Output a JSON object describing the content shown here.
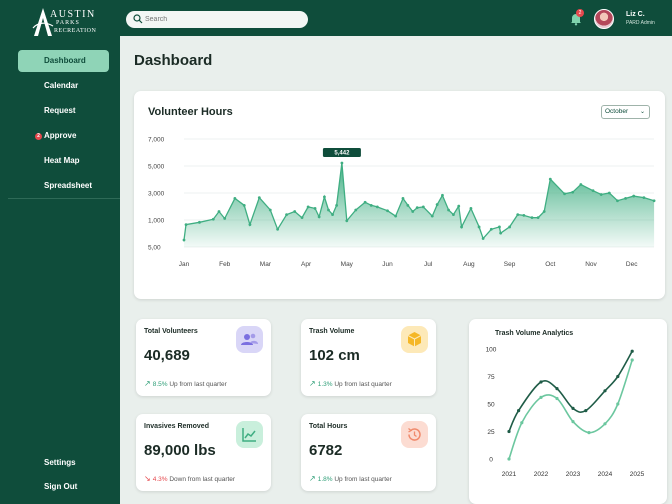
{
  "brand": {
    "line1": "AUSTIN",
    "line2": "PARKS",
    "line3": "RECREATION"
  },
  "search": {
    "placeholder": "Search",
    "value": ""
  },
  "notifications": {
    "count": "2"
  },
  "user": {
    "name": "Liz C.",
    "role": "PARD Admin"
  },
  "sidebar": {
    "items": [
      {
        "label": "Dashboard",
        "active": true
      },
      {
        "label": "Calendar"
      },
      {
        "label": "Request"
      },
      {
        "label": "Approve",
        "badge": "2"
      },
      {
        "label": "Heat Map"
      },
      {
        "label": "Spreadsheet"
      }
    ],
    "bottom": [
      {
        "label": "Settings"
      },
      {
        "label": "Sign Out"
      }
    ]
  },
  "page": {
    "title": "Dashboard"
  },
  "volunteer_hours": {
    "title": "Volunteer Hours",
    "month_select": "October",
    "tooltip": "5,442"
  },
  "stats": [
    {
      "title": "Total Volunteers",
      "value": "40,689",
      "pct": "8.5%",
      "rest": " Up from last quarter",
      "dir": "up",
      "icon": "users-icon",
      "color": "#d9d6f7"
    },
    {
      "title": "Trash Volume",
      "value": "102 cm",
      "pct": "1.3%",
      "rest": " Up from last quarter",
      "dir": "up",
      "icon": "box-icon",
      "color": "#fde9b8"
    },
    {
      "title": "Invasives Removed",
      "value": "89,000 lbs",
      "pct": "4.3%",
      "rest": " Down from last quarter",
      "dir": "down",
      "icon": "chart-icon",
      "color": "#c9efdc"
    },
    {
      "title": "Total Hours",
      "value": "6782",
      "pct": "1.8%",
      "rest": " Up from last quarter",
      "dir": "up",
      "icon": "history-icon",
      "color": "#fcdcd2"
    }
  ],
  "trash_analytics": {
    "title": "Trash Volume Analytics"
  },
  "colors": {
    "primary": "#0f4d3b",
    "accent": "#8fd4b7",
    "area": "#3fae82",
    "danger": "#e5484d"
  },
  "chart_data": [
    {
      "type": "area",
      "title": "Volunteer Hours",
      "categories": [
        "Jan",
        "Feb",
        "Mar",
        "Apr",
        "May",
        "Jun",
        "Jul",
        "Aug",
        "Sep",
        "Oct",
        "Nov",
        "Dec"
      ],
      "yticks": [
        "7,000",
        "5,000",
        "3,000",
        "1,000",
        "5,00"
      ],
      "ylim": [
        0,
        7000
      ],
      "grid": true,
      "x": [
        0.0,
        0.05,
        0.38,
        0.72,
        0.86,
        1.0,
        1.25,
        1.48,
        1.62,
        1.85,
        2.12,
        2.3,
        2.52,
        2.72,
        2.9,
        3.05,
        3.22,
        3.32,
        3.45,
        3.55,
        3.65,
        3.75,
        3.88,
        4.0,
        4.22,
        4.45,
        4.6,
        4.75,
        5.0,
        5.2,
        5.38,
        5.5,
        5.62,
        5.73,
        5.88,
        6.1,
        6.22,
        6.35,
        6.5,
        6.62,
        6.75,
        6.82,
        7.05,
        7.25,
        7.35,
        7.55,
        7.75,
        7.78,
        8.0,
        8.2,
        8.35,
        8.55,
        8.7,
        8.85,
        9.0,
        9.35,
        9.55,
        9.75,
        10.05,
        10.25,
        10.45,
        10.65,
        10.85,
        11.05,
        11.3,
        11.55
      ],
      "values": [
        450,
        1450,
        1600,
        1800,
        2300,
        1850,
        3150,
        2700,
        1450,
        3200,
        2400,
        1150,
        2100,
        2300,
        1900,
        2600,
        2500,
        1950,
        3250,
        2400,
        2100,
        2700,
        5442,
        1700,
        2400,
        2900,
        2700,
        2600,
        2350,
        2000,
        3150,
        2700,
        2300,
        2550,
        2600,
        2000,
        2750,
        3350,
        2400,
        2100,
        2650,
        1300,
        2500,
        1300,
        550,
        1150,
        1300,
        900,
        1300,
        2100,
        2050,
        1900,
        1900,
        2300,
        4400,
        3450,
        3550,
        4050,
        3650,
        3400,
        3500,
        3000,
        3150,
        3300,
        3200,
        3000
      ]
    },
    {
      "type": "line",
      "title": "Trash Volume Analytics",
      "categories": [
        "2021",
        "2022",
        "2023",
        "2024",
        "2025"
      ],
      "yticks": [
        "100",
        "75",
        "50",
        "25",
        "0"
      ],
      "ylim": [
        0,
        100
      ],
      "series": [
        {
          "color": "#1f5c47",
          "x": [
            0,
            0.3,
            1,
            1.5,
            2,
            2.4,
            3,
            3.4,
            3.85
          ],
          "values": [
            25,
            44,
            70,
            64,
            46,
            44,
            62,
            75,
            98
          ]
        },
        {
          "color": "#6cc79f",
          "x": [
            0,
            0.4,
            1,
            1.5,
            2,
            2.5,
            3,
            3.4,
            3.85
          ],
          "values": [
            0,
            33,
            56,
            55,
            34,
            24,
            32,
            50,
            90
          ]
        }
      ]
    }
  ]
}
